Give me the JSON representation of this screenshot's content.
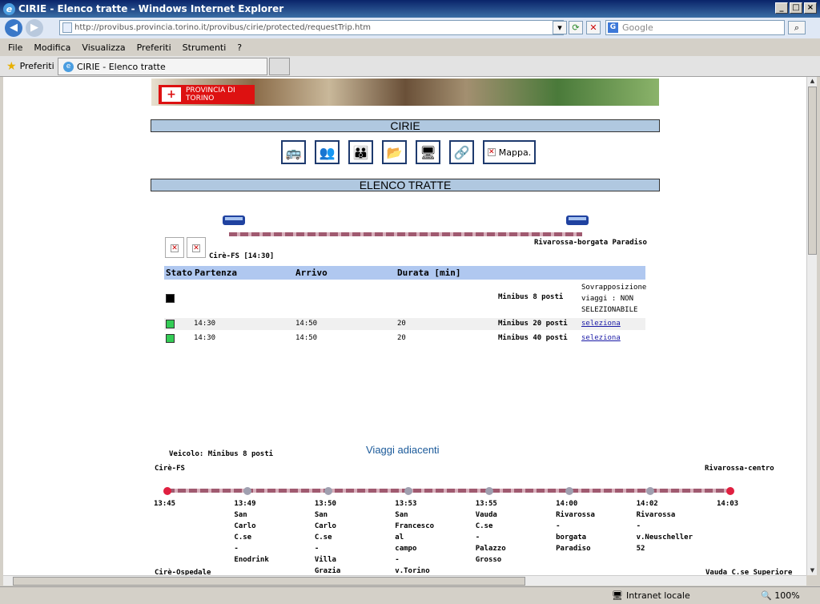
{
  "window": {
    "title": "CIRIE - Elenco tratte - Windows Internet Explorer",
    "btn_min": "_",
    "btn_max": "□",
    "btn_close": "×"
  },
  "address": {
    "url": "http://provibus.provincia.torino.it/provibus/cirie/protected/requestTrip.htm",
    "search_placeholder": "Google",
    "search_icon": "G"
  },
  "menu": [
    "File",
    "Modifica",
    "Visualizza",
    "Preferiti",
    "Strumenti",
    "?"
  ],
  "favbar": {
    "favorites": "Preferiti",
    "tab_title": "CIRIE - Elenco tratte"
  },
  "banner": {
    "logo_text": "PROVINCIA DI TORINO"
  },
  "page": {
    "city": "CIRIE",
    "section": "ELENCO TRATTE",
    "map_button": "Mappa."
  },
  "trip": {
    "destination": "Rivarossa-borgata Paradiso",
    "origin_time": "Cirè-FS [14:30]"
  },
  "table": {
    "headers": {
      "stato": "Stato",
      "partenza": "Partenza",
      "arrivo": "Arrivo",
      "durata": "Durata [min]"
    },
    "rows": [
      {
        "status_color": "#000000",
        "partenza": "",
        "arrivo": "",
        "durata": "",
        "vehicle": "Minibus 8 posti",
        "action": "Sovrapposizione viaggi : NON SELEZIONABILE",
        "action_line1": "Sovrapposizione",
        "action_line2": "viaggi : NON",
        "action_line3": "SELEZIONABILE"
      },
      {
        "status_color": "#33cc55",
        "partenza": "14:30",
        "arrivo": "14:50",
        "durata": "20",
        "vehicle": "Minibus 20 posti",
        "action": "seleziona"
      },
      {
        "status_color": "#33cc55",
        "partenza": "14:30",
        "arrivo": "14:50",
        "durata": "20",
        "vehicle": "Minibus 40 posti",
        "action": "seleziona"
      }
    ]
  },
  "adjacent": {
    "title": "Viaggi adiacenti",
    "vehicle": "Veicolo: Minibus 8 posti",
    "start": "Cirè-FS",
    "end": "Rivarossa-centro",
    "stops": [
      {
        "time": "13:45",
        "name": []
      },
      {
        "time": "13:49",
        "name": [
          "San",
          "Carlo",
          "C.se",
          "-",
          "Enodrink"
        ]
      },
      {
        "time": "13:50",
        "name": [
          "San",
          "Carlo",
          "C.se",
          "-",
          "Villa",
          "Grazia"
        ]
      },
      {
        "time": "13:53",
        "name": [
          "San",
          "Francesco",
          "al",
          "campo",
          "-",
          "v.Torino"
        ]
      },
      {
        "time": "13:55",
        "name": [
          "Vauda",
          "C.se",
          "-",
          "Palazzo",
          "Grosso"
        ]
      },
      {
        "time": "14:00",
        "name": [
          "Rivarossa",
          "-",
          "borgata",
          "Paradiso"
        ]
      },
      {
        "time": "14:02",
        "name": [
          "Rivarossa",
          "-",
          "v.Neuscheller",
          "52"
        ]
      },
      {
        "time": "14:03",
        "name": []
      }
    ],
    "bottom_left": "Cirè-Ospedale",
    "bottom_right": "Vauda C.se Superiore"
  },
  "status": {
    "zone": "Intranet locale",
    "zoom": "100%"
  }
}
